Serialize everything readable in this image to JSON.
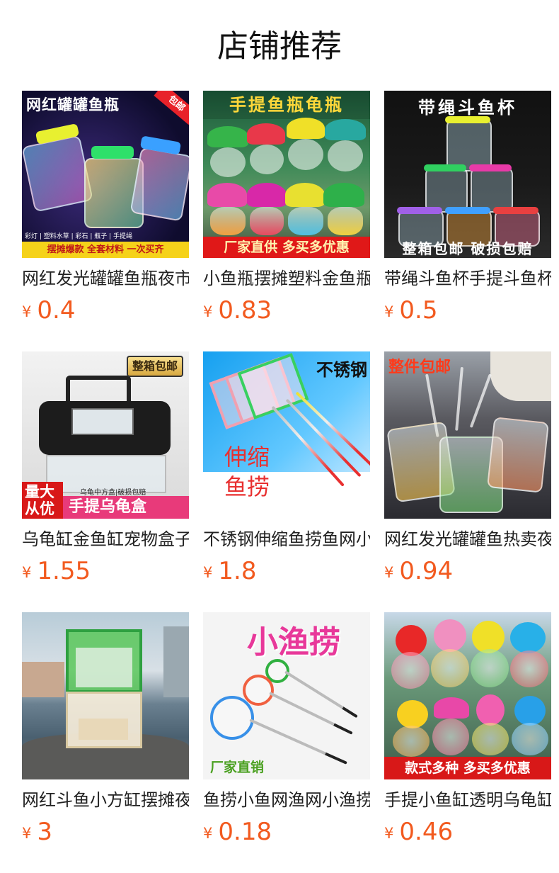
{
  "page_title": "店铺推荐",
  "currency": "¥",
  "products": [
    {
      "name": "网红发光罐罐鱼瓶夜市",
      "price": "0.4",
      "image": {
        "top_text": "网红罐罐鱼瓶",
        "corner_tag": "包邮",
        "small_text": "彩灯 | 塑料水草 | 彩石 | 瓶子 | 手提绳",
        "bottom_text": "摆摊爆款 全套材料 一次买齐"
      }
    },
    {
      "name": "小鱼瓶摆摊塑料金鱼瓶",
      "price": "0.83",
      "image": {
        "top_text": "手提鱼瓶龟瓶",
        "bottom_text": "厂家直供 多买多优惠"
      }
    },
    {
      "name": "带绳斗鱼杯手提斗鱼杯",
      "price": "0.5",
      "image": {
        "top_text": "带绳斗鱼杯",
        "bottom_text": "整箱包邮 破损包赔"
      }
    },
    {
      "name": "乌龟缸金鱼缸宠物盒子",
      "price": "1.55",
      "image": {
        "corner_tag": "整箱包邮",
        "small_text": "乌龟中方盒|破损包赔",
        "side_text_1": "量大",
        "side_text_2": "从优",
        "bottom_text": "手提乌龟盒"
      }
    },
    {
      "name": "不锈钢伸缩鱼捞鱼网小",
      "price": "1.8",
      "image": {
        "top_text": "不锈钢",
        "mid_text_1": "伸缩",
        "mid_text_2": "鱼捞"
      }
    },
    {
      "name": "网红发光罐罐鱼热卖夜",
      "price": "0.94",
      "image": {
        "top_text": "整件包邮"
      }
    },
    {
      "name": "网红斗鱼小方缸摆摊夜",
      "price": "3",
      "image": {}
    },
    {
      "name": "鱼捞小鱼网渔网小渔捞",
      "price": "0.18",
      "image": {
        "top_text": "小渔捞",
        "bottom_text": "厂家直销"
      }
    },
    {
      "name": "手提小鱼缸透明乌龟缸",
      "price": "0.46",
      "image": {
        "bottom_text": "款式多种 多买多优惠"
      }
    }
  ],
  "colors": {
    "price": "#f25a1f",
    "title": "#111111",
    "name": "#222222"
  }
}
